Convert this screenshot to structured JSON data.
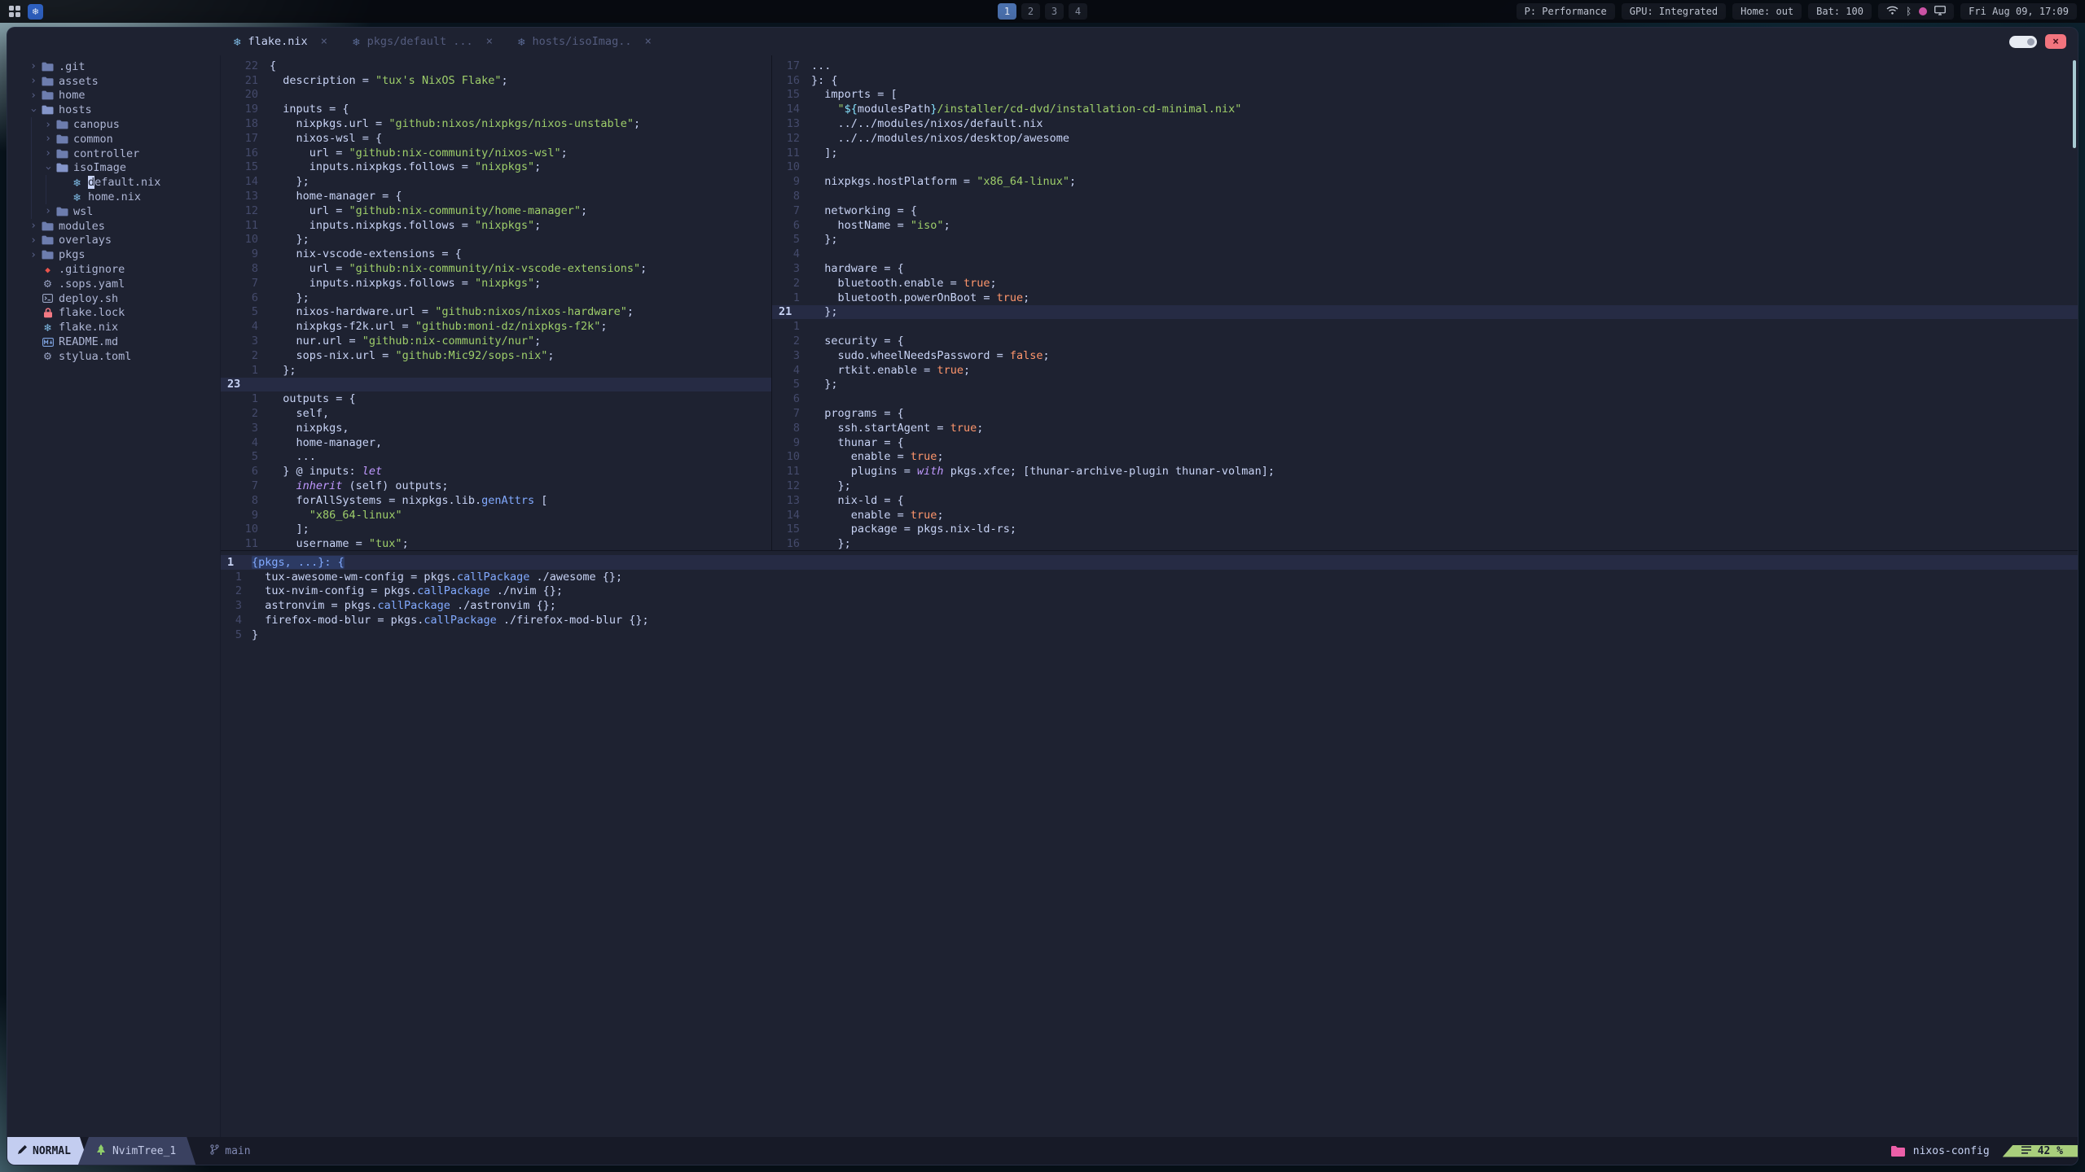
{
  "topbar": {
    "workspaces": [
      "1",
      "2",
      "3",
      "4"
    ],
    "active_workspace": "1",
    "stats": [
      "P: Performance",
      "GPU: Integrated",
      "Home: out",
      "Bat: 100"
    ],
    "clock": "Fri Aug 09, 17:09"
  },
  "icons": {
    "nix": "❄",
    "gear": "⚙",
    "git": "◆",
    "chevron": "›",
    "close": "×",
    "bluetooth": "ᛒ"
  },
  "colors": {
    "string_green": "#9ece6a",
    "boolean_orange": "#ff966c",
    "keyword_purple": "#c099ff",
    "function_blue": "#82aaff",
    "nix_blue": "#7ebae4",
    "mode_bg": "#c3cdf0",
    "scroll_bg": "#a9ce7c",
    "project_pink": "#ec5fa8",
    "close_red": "#f2747e"
  },
  "window": {
    "tabs": [
      {
        "label": "flake.nix",
        "active": true
      },
      {
        "label": "pkgs/default ...",
        "active": false
      },
      {
        "label": "hosts/isoImag..",
        "active": false
      }
    ]
  },
  "tree": {
    "items": [
      {
        "depth": 0,
        "arrow": true,
        "open": false,
        "icon": "folder",
        "label": ".git"
      },
      {
        "depth": 0,
        "arrow": true,
        "open": false,
        "icon": "folder",
        "label": "assets"
      },
      {
        "depth": 0,
        "arrow": true,
        "open": false,
        "icon": "folder",
        "label": "home"
      },
      {
        "depth": 0,
        "arrow": true,
        "open": true,
        "icon": "folder-open",
        "label": "hosts"
      },
      {
        "depth": 1,
        "arrow": true,
        "open": false,
        "icon": "folder",
        "label": "canopus"
      },
      {
        "depth": 1,
        "arrow": true,
        "open": false,
        "icon": "folder",
        "label": "common"
      },
      {
        "depth": 1,
        "arrow": true,
        "open": false,
        "icon": "folder",
        "label": "controller"
      },
      {
        "depth": 1,
        "arrow": true,
        "open": true,
        "icon": "folder-open",
        "label": "isoImage"
      },
      {
        "depth": 2,
        "arrow": false,
        "icon": "nix",
        "label": "default.nix",
        "cursor": true
      },
      {
        "depth": 2,
        "arrow": false,
        "icon": "nix",
        "label": "home.nix"
      },
      {
        "depth": 1,
        "arrow": true,
        "open": false,
        "icon": "folder",
        "label": "wsl"
      },
      {
        "depth": 0,
        "arrow": true,
        "open": false,
        "icon": "folder",
        "label": "modules"
      },
      {
        "depth": 0,
        "arrow": true,
        "open": false,
        "icon": "folder",
        "label": "overlays"
      },
      {
        "depth": 0,
        "arrow": true,
        "open": false,
        "icon": "folder",
        "label": "pkgs"
      },
      {
        "depth": 0,
        "arrow": false,
        "icon": "git",
        "label": ".gitignore"
      },
      {
        "depth": 0,
        "arrow": false,
        "icon": "gear",
        "label": ".sops.yaml"
      },
      {
        "depth": 0,
        "arrow": false,
        "icon": "shell",
        "label": "deploy.sh"
      },
      {
        "depth": 0,
        "arrow": false,
        "icon": "lock",
        "label": "flake.lock"
      },
      {
        "depth": 0,
        "arrow": false,
        "icon": "nix",
        "label": "flake.nix"
      },
      {
        "depth": 0,
        "arrow": false,
        "icon": "md",
        "label": "README.md"
      },
      {
        "depth": 0,
        "arrow": false,
        "icon": "gear",
        "label": "stylua.toml"
      }
    ]
  },
  "editors": {
    "left": {
      "file": "flake.nix",
      "lines": [
        {
          "n": "22",
          "t": [
            [
              "p",
              "{"
            ]
          ]
        },
        {
          "n": "21",
          "t": [
            [
              "p",
              "  description = "
            ],
            [
              "s",
              "\"tux's NixOS Flake\""
            ],
            [
              "p",
              ";"
            ]
          ]
        },
        {
          "n": "20",
          "t": []
        },
        {
          "n": "19",
          "t": [
            [
              "p",
              "  inputs = {"
            ]
          ]
        },
        {
          "n": "18",
          "t": [
            [
              "p",
              "    nixpkgs.url = "
            ],
            [
              "s",
              "\"github:nixos/nixpkgs/nixos-unstable\""
            ],
            [
              "p",
              ";"
            ]
          ]
        },
        {
          "n": "17",
          "t": [
            [
              "p",
              "    nixos-wsl = {"
            ]
          ]
        },
        {
          "n": "16",
          "t": [
            [
              "p",
              "      url = "
            ],
            [
              "s",
              "\"github:nix-community/nixos-wsl\""
            ],
            [
              "p",
              ";"
            ]
          ]
        },
        {
          "n": "15",
          "t": [
            [
              "p",
              "      inputs.nixpkgs.follows = "
            ],
            [
              "s",
              "\"nixpkgs\""
            ],
            [
              "p",
              ";"
            ]
          ]
        },
        {
          "n": "14",
          "t": [
            [
              "p",
              "    };"
            ]
          ]
        },
        {
          "n": "13",
          "t": [
            [
              "p",
              "    home-manager = {"
            ]
          ]
        },
        {
          "n": "12",
          "t": [
            [
              "p",
              "      url = "
            ],
            [
              "s",
              "\"github:nix-community/home-manager\""
            ],
            [
              "p",
              ";"
            ]
          ]
        },
        {
          "n": "11",
          "t": [
            [
              "p",
              "      inputs.nixpkgs.follows = "
            ],
            [
              "s",
              "\"nixpkgs\""
            ],
            [
              "p",
              ";"
            ]
          ]
        },
        {
          "n": "10",
          "t": [
            [
              "p",
              "    };"
            ]
          ]
        },
        {
          "n": "9",
          "t": [
            [
              "p",
              "    nix-vscode-extensions = {"
            ]
          ]
        },
        {
          "n": "8",
          "t": [
            [
              "p",
              "      url = "
            ],
            [
              "s",
              "\"github:nix-community/nix-vscode-extensions\""
            ],
            [
              "p",
              ";"
            ]
          ]
        },
        {
          "n": "7",
          "t": [
            [
              "p",
              "      inputs.nixpkgs.follows = "
            ],
            [
              "s",
              "\"nixpkgs\""
            ],
            [
              "p",
              ";"
            ]
          ]
        },
        {
          "n": "6",
          "t": [
            [
              "p",
              "    };"
            ]
          ]
        },
        {
          "n": "5",
          "t": [
            [
              "p",
              "    nixos-hardware.url = "
            ],
            [
              "s",
              "\"github:nixos/nixos-hardware\""
            ],
            [
              "p",
              ";"
            ]
          ]
        },
        {
          "n": "4",
          "t": [
            [
              "p",
              "    nixpkgs-f2k.url = "
            ],
            [
              "s",
              "\"github:moni-dz/nixpkgs-f2k\""
            ],
            [
              "p",
              ";"
            ]
          ]
        },
        {
          "n": "3",
          "t": [
            [
              "p",
              "    nur.url = "
            ],
            [
              "s",
              "\"github:nix-community/nur\""
            ],
            [
              "p",
              ";"
            ]
          ]
        },
        {
          "n": "2",
          "t": [
            [
              "p",
              "    sops-nix.url = "
            ],
            [
              "s",
              "\"github:Mic92/sops-nix\""
            ],
            [
              "p",
              ";"
            ]
          ]
        },
        {
          "n": "1",
          "t": [
            [
              "p",
              "  };"
            ]
          ]
        },
        {
          "n": "23",
          "cur": true,
          "t": []
        },
        {
          "n": "1",
          "t": [
            [
              "p",
              "  outputs = {"
            ]
          ]
        },
        {
          "n": "2",
          "t": [
            [
              "p",
              "    self,"
            ]
          ]
        },
        {
          "n": "3",
          "t": [
            [
              "p",
              "    nixpkgs,"
            ]
          ]
        },
        {
          "n": "4",
          "t": [
            [
              "p",
              "    home-manager,"
            ]
          ]
        },
        {
          "n": "5",
          "t": [
            [
              "p",
              "    ..."
            ]
          ]
        },
        {
          "n": "6",
          "t": [
            [
              "p",
              "  } @ inputs: "
            ],
            [
              "k",
              "let"
            ]
          ]
        },
        {
          "n": "7",
          "t": [
            [
              "k",
              "    inherit"
            ],
            [
              "p",
              " (self) outputs;"
            ]
          ]
        },
        {
          "n": "8",
          "t": [
            [
              "p",
              "    forAllSystems = nixpkgs.lib."
            ],
            [
              "f",
              "genAttrs"
            ],
            [
              "p",
              " ["
            ]
          ]
        },
        {
          "n": "9",
          "t": [
            [
              "p",
              "      "
            ],
            [
              "s",
              "\"x86_64-linux\""
            ]
          ]
        },
        {
          "n": "10",
          "t": [
            [
              "p",
              "    ];"
            ]
          ]
        },
        {
          "n": "11",
          "t": [
            [
              "p",
              "    username = "
            ],
            [
              "s",
              "\"tux\""
            ],
            [
              "p",
              ";"
            ]
          ]
        }
      ]
    },
    "right": {
      "file": "hosts/isoImage/default.nix",
      "lines": [
        {
          "n": "17",
          "t": [
            [
              "p",
              "..."
            ]
          ]
        },
        {
          "n": "16",
          "t": [
            [
              "p",
              "}: {"
            ]
          ]
        },
        {
          "n": "15",
          "t": [
            [
              "p",
              "  imports = ["
            ]
          ]
        },
        {
          "n": "14",
          "t": [
            [
              "p",
              "    "
            ],
            [
              "s",
              "\""
            ],
            [
              "c",
              "${"
            ],
            [
              "p",
              "modulesPath"
            ],
            [
              "c",
              "}"
            ],
            [
              "s",
              "/installer/cd-dvd/installation-cd-minimal.nix\""
            ]
          ]
        },
        {
          "n": "13",
          "t": [
            [
              "p",
              "    ../../modules/nixos/default.nix"
            ]
          ]
        },
        {
          "n": "12",
          "t": [
            [
              "p",
              "    ../../modules/nixos/desktop/awesome"
            ]
          ]
        },
        {
          "n": "11",
          "t": [
            [
              "p",
              "  ];"
            ]
          ]
        },
        {
          "n": "10",
          "t": []
        },
        {
          "n": "9",
          "t": [
            [
              "p",
              "  nixpkgs.hostPlatform = "
            ],
            [
              "s",
              "\"x86_64-linux\""
            ],
            [
              "p",
              ";"
            ]
          ]
        },
        {
          "n": "8",
          "t": []
        },
        {
          "n": "7",
          "t": [
            [
              "p",
              "  networking = {"
            ]
          ]
        },
        {
          "n": "6",
          "t": [
            [
              "p",
              "    hostName = "
            ],
            [
              "s",
              "\"iso\""
            ],
            [
              "p",
              ";"
            ]
          ]
        },
        {
          "n": "5",
          "t": [
            [
              "p",
              "  };"
            ]
          ]
        },
        {
          "n": "4",
          "t": []
        },
        {
          "n": "3",
          "t": [
            [
              "p",
              "  hardware = {"
            ]
          ]
        },
        {
          "n": "2",
          "t": [
            [
              "p",
              "    bluetooth.enable = "
            ],
            [
              "b",
              "true"
            ],
            [
              "p",
              ";"
            ]
          ]
        },
        {
          "n": "1",
          "t": [
            [
              "p",
              "    bluetooth.powerOnBoot = "
            ],
            [
              "b",
              "true"
            ],
            [
              "p",
              ";"
            ]
          ]
        },
        {
          "n": "21",
          "cur": true,
          "t": [
            [
              "p",
              "  };"
            ]
          ]
        },
        {
          "n": "1",
          "t": []
        },
        {
          "n": "2",
          "t": [
            [
              "p",
              "  security = {"
            ]
          ]
        },
        {
          "n": "3",
          "t": [
            [
              "p",
              "    sudo.wheelNeedsPassword = "
            ],
            [
              "b",
              "false"
            ],
            [
              "p",
              ";"
            ]
          ]
        },
        {
          "n": "4",
          "t": [
            [
              "p",
              "    rtkit.enable = "
            ],
            [
              "b",
              "true"
            ],
            [
              "p",
              ";"
            ]
          ]
        },
        {
          "n": "5",
          "t": [
            [
              "p",
              "  };"
            ]
          ]
        },
        {
          "n": "6",
          "t": []
        },
        {
          "n": "7",
          "t": [
            [
              "p",
              "  programs = {"
            ]
          ]
        },
        {
          "n": "8",
          "t": [
            [
              "p",
              "    ssh.startAgent = "
            ],
            [
              "b",
              "true"
            ],
            [
              "p",
              ";"
            ]
          ]
        },
        {
          "n": "9",
          "t": [
            [
              "p",
              "    thunar = {"
            ]
          ]
        },
        {
          "n": "10",
          "t": [
            [
              "p",
              "      enable = "
            ],
            [
              "b",
              "true"
            ],
            [
              "p",
              ";"
            ]
          ]
        },
        {
          "n": "11",
          "t": [
            [
              "p",
              "      plugins = "
            ],
            [
              "k",
              "with"
            ],
            [
              "p",
              " pkgs.xfce; [thunar-archive-plugin thunar-volman];"
            ]
          ]
        },
        {
          "n": "12",
          "t": [
            [
              "p",
              "    };"
            ]
          ]
        },
        {
          "n": "13",
          "t": [
            [
              "p",
              "    nix-ld = {"
            ]
          ]
        },
        {
          "n": "14",
          "t": [
            [
              "p",
              "      enable = "
            ],
            [
              "b",
              "true"
            ],
            [
              "p",
              ";"
            ]
          ]
        },
        {
          "n": "15",
          "t": [
            [
              "p",
              "      package = pkgs.nix-ld-rs;"
            ]
          ]
        },
        {
          "n": "16",
          "t": [
            [
              "p",
              "    };"
            ]
          ]
        }
      ]
    },
    "bottom": {
      "file": "pkgs/default.nix",
      "lines": [
        {
          "n": "1",
          "cur": true,
          "sel": true,
          "t": [
            [
              "f",
              "{pkgs, ...}: {"
            ]
          ]
        },
        {
          "n": "1",
          "t": [
            [
              "p",
              "  tux-awesome-wm-config = pkgs."
            ],
            [
              "f",
              "callPackage"
            ],
            [
              "p",
              " ./awesome {};"
            ]
          ]
        },
        {
          "n": "2",
          "t": [
            [
              "p",
              "  tux-nvim-config = pkgs."
            ],
            [
              "f",
              "callPackage"
            ],
            [
              "p",
              " ./nvim {};"
            ]
          ]
        },
        {
          "n": "3",
          "t": [
            [
              "p",
              "  astronvim = pkgs."
            ],
            [
              "f",
              "callPackage"
            ],
            [
              "p",
              " ./astronvim {};"
            ]
          ]
        },
        {
          "n": "4",
          "t": [
            [
              "p",
              "  firefox-mod-blur = pkgs."
            ],
            [
              "f",
              "callPackage"
            ],
            [
              "p",
              " ./firefox-mod-blur {};"
            ]
          ]
        },
        {
          "n": "5",
          "t": [
            [
              "p",
              "}"
            ]
          ]
        }
      ]
    }
  },
  "statusline": {
    "mode": "NORMAL",
    "buffer": "NvimTree_1",
    "branch": "main",
    "project": "nixos-config",
    "scroll": "42 %"
  }
}
